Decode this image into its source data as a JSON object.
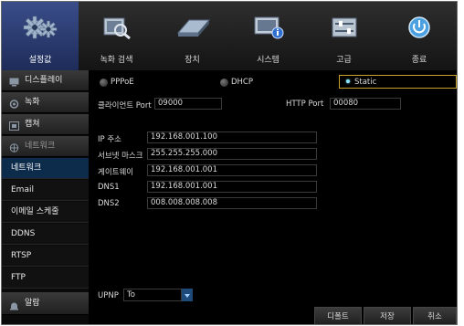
{
  "topbar": {
    "tabs": [
      {
        "label": "설정값",
        "icon": "settings-gears-icon"
      },
      {
        "label": "녹화 검색",
        "icon": "record-search-icon"
      },
      {
        "label": "장치",
        "icon": "device-disk-icon"
      },
      {
        "label": "시스템",
        "icon": "system-monitor-info-icon"
      },
      {
        "label": "고급",
        "icon": "advanced-sliders-icon"
      },
      {
        "label": "종료",
        "icon": "power-icon"
      }
    ]
  },
  "sidebar": {
    "items": [
      {
        "label": "디스플레이",
        "icon": "monitor-icon"
      },
      {
        "label": "녹화",
        "icon": "record-icon"
      },
      {
        "label": "캡쳐",
        "icon": "capture-icon"
      },
      {
        "label": "네트워크",
        "icon": "network-icon"
      },
      {
        "label": "네트워크"
      },
      {
        "label": "Email"
      },
      {
        "label": "이메일 스케줄"
      },
      {
        "label": "DDNS"
      },
      {
        "label": "RTSP"
      },
      {
        "label": "FTP"
      },
      {
        "label": "알람",
        "icon": "alarm-icon"
      }
    ]
  },
  "network": {
    "modes": {
      "pppoe": "PPPoE",
      "dhcp": "DHCP",
      "static": "Static",
      "selected": "Static"
    },
    "client_port_label": "클라이언트 Port",
    "client_port": "09000",
    "http_port_label": "HTTP Port",
    "http_port": "00080",
    "ip_label": "IP 주소",
    "ip": "192.168.001.100",
    "subnet_label": "서브넷 마스크",
    "subnet": "255.255.255.000",
    "gateway_label": "게이트웨이",
    "gateway": "192.168.001.001",
    "dns1_label": "DNS1",
    "dns1": "192.168.001.001",
    "dns2_label": "DNS2",
    "dns2": "008.008.008.008",
    "upnp_label": "UPNP",
    "upnp_value": "To"
  },
  "buttons": {
    "default": "디폴트",
    "save": "저장",
    "cancel": "취소"
  },
  "colors": {
    "active_tab": "#2d4a8a",
    "selected_item": "#0d2b4a",
    "radio_selected": "#8de8ff"
  }
}
